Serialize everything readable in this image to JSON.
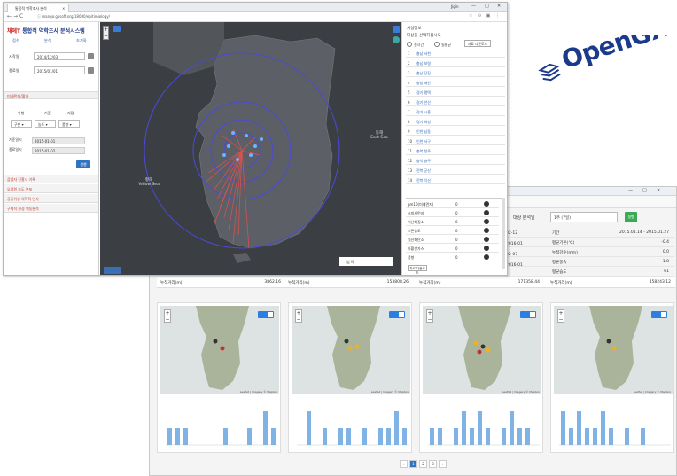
{
  "logo": {
    "text": "OpenGXT",
    "color": "#1b3a8c"
  },
  "front_window": {
    "tab_title": "통합적 역학조사 분석",
    "user_name": "Jigin",
    "window_buttons": [
      "—",
      "□",
      "✕"
    ],
    "url": "ⓘ mango.gxsoft.org:18080/epitimiology/",
    "app": {
      "brand": "채에T",
      "title": "통합적 역학조사 분석시스템",
      "subnav": [
        "접수",
        "분석",
        "초기화"
      ]
    },
    "fields": [
      {
        "label": "시작일",
        "value": "2014/12/03"
      },
      {
        "label": "종료일",
        "value": "2015/01/01"
      }
    ],
    "section_title": "미세먼지/황사",
    "group_headers": [
      "유형",
      "기준",
      "지점"
    ],
    "group_selects": [
      "구분 ▾",
      "농도 ▾",
      "풍향 ▾"
    ],
    "date_rows": [
      {
        "label": "기준일시",
        "value": "2015-01-01"
      },
      {
        "label": "종료일시",
        "value": "2015-01-02"
      }
    ],
    "run_label": "실행",
    "accordion": [
      "감염자 진찰시 기록",
      "오염원 농도 분포",
      "공중위생 의학적 인식",
      "구체적 환경 역동분석"
    ],
    "map_labels": [
      {
        "text": "동해\nEast Sea"
      },
      {
        "text": "황해\nYellow Sea"
      }
    ],
    "map_legend": "범 례",
    "right_panel": {
      "title": "시설정보",
      "subtitle": "대상을 선택하십시오",
      "radio_options": [
        "실시간",
        "일평균"
      ],
      "button": "자료 다운로드",
      "sites": [
        "충남 서천",
        "충남 보령",
        "충남 당진",
        "충남 태안",
        "경기 평택",
        "경기 안산",
        "경기 시흥",
        "경기 화성",
        "인천 남동",
        "인천 서구",
        "충북 청주",
        "충북 충주",
        "전북 군산",
        "전북 익산"
      ],
      "pollutants": [
        {
          "name": "pm10(미세먼지)",
          "value": "0"
        },
        {
          "name": "초미세먼지",
          "value": "0"
        },
        {
          "name": "이산화질소",
          "value": "0"
        },
        {
          "name": "오존농도",
          "value": "0"
        },
        {
          "name": "일산화탄소",
          "value": "0"
        },
        {
          "name": "아황산가스",
          "value": "0"
        },
        {
          "name": "풍향",
          "value": "0"
        }
      ],
      "pollutant_button": "자료 다운로드"
    }
  },
  "back_window": {
    "control_label": "대상 분석일",
    "select_value": "1주 (7일)",
    "go_label": "실행",
    "left_stats": [
      {
        "label": "02-12",
        "value": ""
      },
      {
        "label": "2016-01",
        "value": ""
      },
      {
        "label": "02-07",
        "value": ""
      },
      {
        "label": "2016-01",
        "value": ""
      }
    ],
    "stats": [
      {
        "k": "기간",
        "v": "2015.01.14 - 2015.01.27"
      },
      {
        "k": "평균기온(℃)",
        "v": "-0.4"
      },
      {
        "k": "누적강수(mm)",
        "v": "0.0"
      },
      {
        "k": "평균풍속",
        "v": "1.8"
      },
      {
        "k": "평균습도",
        "v": "61"
      }
    ],
    "card_headers": [
      {
        "label": "누적거리(m)",
        "value": "3862.16"
      },
      {
        "label": "누적거리(m)",
        "value": "153808.26"
      },
      {
        "label": "누적거리(m)",
        "value": "171358.44"
      },
      {
        "label": "누적거리(m)",
        "value": "458243.12"
      }
    ],
    "map_attribution": "Leaflet | Imagery © Mapbox",
    "bar_values": [
      [
        1,
        1,
        1,
        0,
        0,
        0,
        0,
        1,
        0,
        0,
        1,
        0,
        2,
        1
      ],
      [
        0,
        2,
        0,
        1,
        0,
        1,
        1,
        0,
        1,
        0,
        1,
        1,
        2,
        1
      ],
      [
        1,
        1,
        0,
        1,
        2,
        1,
        2,
        1,
        0,
        1,
        2,
        1,
        1,
        0
      ],
      [
        2,
        1,
        2,
        1,
        1,
        2,
        1,
        0,
        1,
        0,
        1,
        0,
        0,
        0
      ]
    ],
    "pages": [
      "‹",
      "1",
      "2",
      "3",
      "›"
    ]
  }
}
